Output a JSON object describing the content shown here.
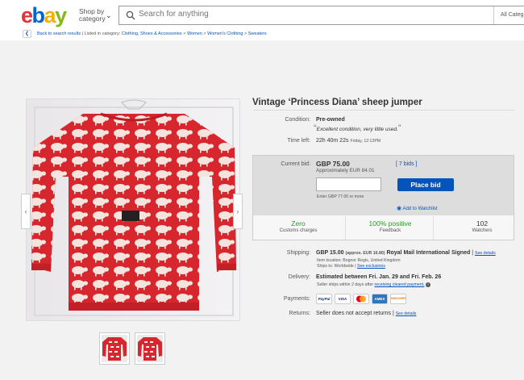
{
  "header": {
    "logo_letters": [
      {
        "ch": "e",
        "color": "#e53238"
      },
      {
        "ch": "b",
        "color": "#0064d2"
      },
      {
        "ch": "a",
        "color": "#f5af02"
      },
      {
        "ch": "y",
        "color": "#86b817"
      }
    ],
    "shop_by_line1": "Shop by",
    "shop_by_line2": "category",
    "search_placeholder": "Search for anything",
    "all_categories": "All Categ"
  },
  "breadcrumb": {
    "back": "Back to search results",
    "listed_in": "Listed in category:",
    "items": [
      "Clothing, Shoes & Accessories",
      "Women",
      "Women's Clothing",
      "Sweaters"
    ]
  },
  "item": {
    "title": "Vintage ‘Princess Diana’ sheep jumper",
    "condition_label": "Condition:",
    "condition": "Pre-owned",
    "condition_quote": "Excellent condition, very little used.",
    "time_left_label": "Time left:",
    "time_left": "22h 40m 22s",
    "time_left_end": "Friday, 12:12PM",
    "current_bid_label": "Current bid:",
    "current_bid": "GBP 75.00",
    "approx_bid": "Approximately EUR 84.01",
    "bids": "[ 7 bids ]",
    "enter_hint": "Enter GBP 77.00 or more",
    "place_bid": "Place bid",
    "add_watchlist": "Add to Watchlist",
    "stats": [
      {
        "value": "Zero",
        "label": "Customs charges"
      },
      {
        "value": "100% positive",
        "label": "Feedback"
      },
      {
        "value": "102",
        "label": "Watchers"
      }
    ],
    "shipping_label": "Shipping:",
    "shipping_price": "GBP 15.00",
    "shipping_approx": "(approx. EUR 16.80)",
    "shipping_method": "Royal Mail International Signed",
    "see_details": "See details",
    "item_location": "Item location:  Bognor Regis, United Kingdom",
    "ships_to": "Ships to:  Worldwide",
    "see_exclusions": "See exclusions",
    "delivery_label": "Delivery:",
    "delivery": "Estimated between Fri. Jan. 29 and Fri. Feb. 26",
    "delivery_note": "Seller ships within 2 days after",
    "cleared_payment": "receiving cleared payment.",
    "payments_label": "Payments:",
    "payments": [
      "PayPal",
      "VISA",
      "MC",
      "AMEX",
      "DISCOVER"
    ],
    "returns_label": "Returns:",
    "returns": "Seller does not accept returns",
    "returns_details": "See details"
  }
}
